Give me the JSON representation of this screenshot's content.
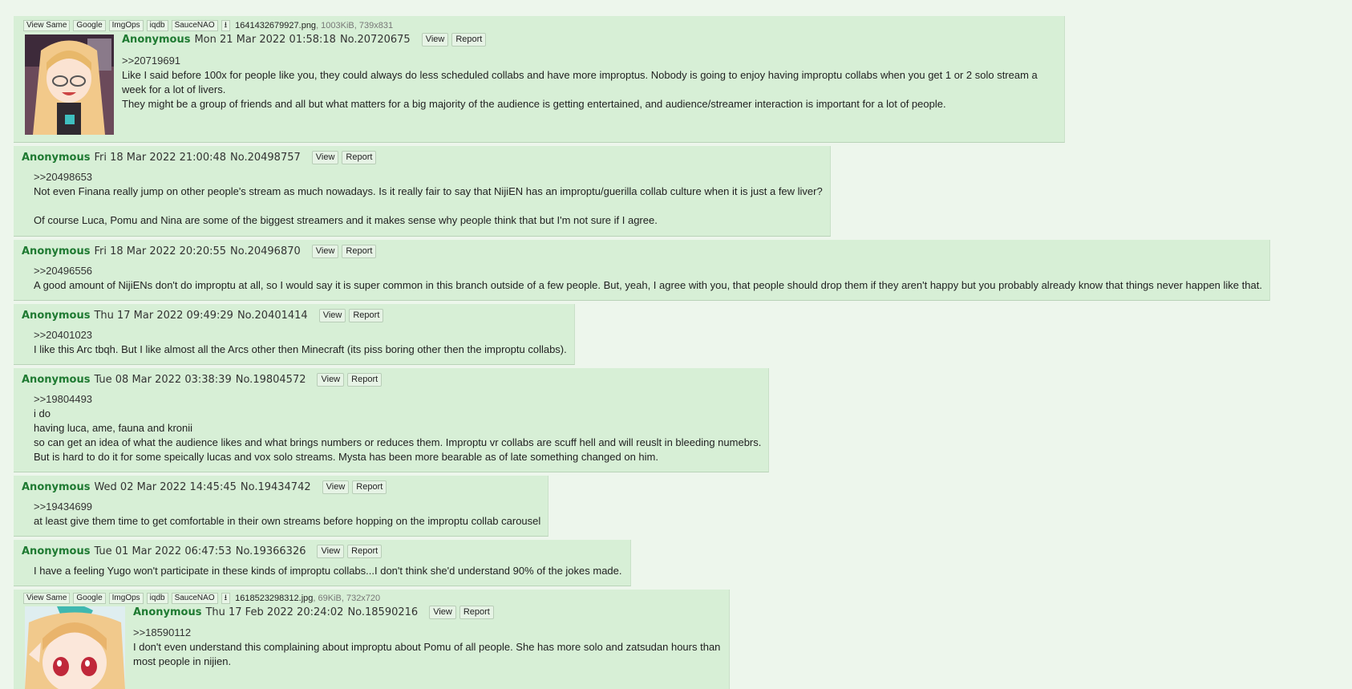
{
  "buttons": {
    "view": "View",
    "report": "Report"
  },
  "image_tools": [
    "View Same",
    "Google",
    "ImgOps",
    "iqdb",
    "SauceNAO"
  ],
  "download_icon": "download-icon",
  "posts": [
    {
      "file": {
        "name": "1641432679927.png",
        "meta": ", 1003KiB, 739x831"
      },
      "name": "Anonymous",
      "date": "Mon 21 Mar 2022 01:58:18",
      "no": "No.20720675",
      "lines": [
        ">>20719691",
        "Like I said before 100x for people like you, they could always do less scheduled collabs and have more improptus. Nobody is going to enjoy having improptu collabs when you get 1 or 2 solo stream a week for a lot of livers.",
        "They might be a group of friends and all but what matters for a big majority of the audience is getting entertained, and audience/streamer interaction is important for a lot of people."
      ]
    },
    {
      "name": "Anonymous",
      "date": "Fri 18 Mar 2022 21:00:48",
      "no": "No.20498757",
      "lines": [
        ">>20498653",
        "Not even Finana really jump on other people's stream as much nowadays. Is it really fair to say that NijiEN has an improptu/guerilla collab culture when it is just a few liver?",
        "",
        "Of course Luca, Pomu and Nina are some of the biggest streamers and it makes sense why people think that but I'm not sure if I agree."
      ]
    },
    {
      "name": "Anonymous",
      "date": "Fri 18 Mar 2022 20:20:55",
      "no": "No.20496870",
      "lines": [
        ">>20496556",
        "A good amount of NijiENs don't do improptu at all, so I would say it is super common in this branch outside of a few people. But, yeah, I agree with you, that people should drop them if they aren't happy but you probably already know that things never happen like that."
      ]
    },
    {
      "name": "Anonymous",
      "date": "Thu 17 Mar 2022 09:49:29",
      "no": "No.20401414",
      "lines": [
        ">>20401023",
        "I like this Arc tbqh. But I like almost all the Arcs other then Minecraft (its piss boring other then the improptu collabs)."
      ]
    },
    {
      "name": "Anonymous",
      "date": "Tue 08 Mar 2022 03:38:39",
      "no": "No.19804572",
      "lines": [
        ">>19804493",
        "i do",
        "having luca, ame, fauna and kronii",
        "so can get an idea of what the audience likes and what brings numbers or reduces them. Improptu vr collabs are scuff hell and will reuslt in bleeding numebrs.",
        "But is hard to do it for some speically lucas and vox solo streams. Mysta has been more bearable as of late something changed on him."
      ]
    },
    {
      "name": "Anonymous",
      "date": "Wed 02 Mar 2022 14:45:45",
      "no": "No.19434742",
      "lines": [
        ">>19434699",
        "at least give them time to get comfortable in their own streams before hopping on the improptu collab carousel"
      ]
    },
    {
      "name": "Anonymous",
      "date": "Tue 01 Mar 2022 06:47:53",
      "no": "No.19366326",
      "lines": [
        "I have a feeling Yugo won't participate in these kinds of improptu collabs...I don't think she'd understand 90% of the jokes made."
      ]
    },
    {
      "file": {
        "name": "1618523298312.jpg",
        "meta": ", 69KiB, 732x720"
      },
      "name": "Anonymous",
      "date": "Thu 17 Feb 2022 20:24:02",
      "no": "No.18590216",
      "lines": [
        ">>18590112",
        "I don't even understand this complaining about improptu about Pomu of all people. She has more solo and zatsudan hours than most people in nijien."
      ]
    }
  ]
}
